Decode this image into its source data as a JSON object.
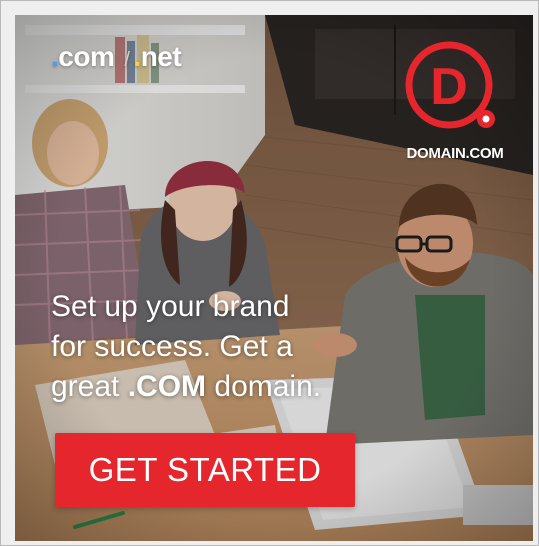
{
  "ad": {
    "tlds": {
      "com": "com",
      "net": "net",
      "separator": "/"
    },
    "brand": {
      "logo_letter": "D",
      "name": "DOMAIN.COM"
    },
    "headline": {
      "line1": "Set up your brand",
      "line2": "for success. Get a",
      "line3_pre": "great ",
      "line3_strong": ".COM",
      "line3_post": " domain."
    },
    "cta_label": "GET STARTED",
    "colors": {
      "brand_red": "#e5262d",
      "dot_blue": "#3fa0ff",
      "dot_yellow": "#ffd12a",
      "text": "#ffffff"
    }
  }
}
